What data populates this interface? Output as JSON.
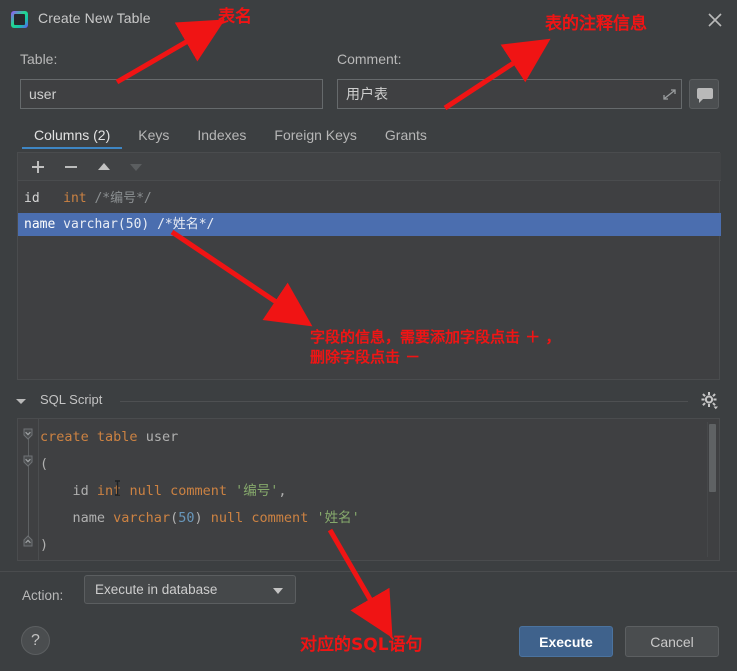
{
  "window": {
    "title": "Create New Table",
    "app_icon": "datagrip-logo-icon",
    "close_icon": "close-icon"
  },
  "form": {
    "table_label": "Table:",
    "table_value": "user",
    "table_placeholder": "",
    "comment_label": "Comment:",
    "comment_value": "用户表",
    "comment_placeholder": "",
    "expand_icon": "expand-icon",
    "comment_button_icon": "speech-bubble-icon"
  },
  "tabs": [
    {
      "label": "Columns (2)",
      "active": true
    },
    {
      "label": "Keys",
      "active": false
    },
    {
      "label": "Indexes",
      "active": false
    },
    {
      "label": "Foreign Keys",
      "active": false
    },
    {
      "label": "Grants",
      "active": false
    }
  ],
  "columns_toolbar": [
    {
      "name": "add-column-button",
      "icon": "plus-icon",
      "label": "+",
      "enabled": true
    },
    {
      "name": "remove-column-button",
      "icon": "minus-icon",
      "label": "−",
      "enabled": true
    },
    {
      "name": "move-up-button",
      "icon": "arrow-up-icon",
      "label": "▲",
      "enabled": true
    },
    {
      "name": "move-down-button",
      "icon": "arrow-down-icon",
      "label": "▼",
      "enabled": false
    }
  ],
  "columns": [
    {
      "name": "id",
      "type": "int",
      "comment": "/*编号*/",
      "selected": false
    },
    {
      "name": "name",
      "type": "varchar(50)",
      "comment": "/*姓名*/",
      "selected": true
    }
  ],
  "sql_section": {
    "title": "SQL Script",
    "collapse_icon": "caret-down-icon",
    "settings_icon": "gear-icon",
    "lines": [
      {
        "indent": 0,
        "tokens": [
          {
            "t": "create",
            "c": "k"
          },
          {
            "t": " ",
            "c": "p"
          },
          {
            "t": "table",
            "c": "k"
          },
          {
            "t": " ",
            "c": "p"
          },
          {
            "t": "user",
            "c": "p"
          }
        ]
      },
      {
        "indent": 0,
        "tokens": [
          {
            "t": "(",
            "c": "p"
          }
        ]
      },
      {
        "indent": 1,
        "tokens": [
          {
            "t": "id",
            "c": "p"
          },
          {
            "t": " ",
            "c": "p"
          },
          {
            "t": "int",
            "c": "k"
          },
          {
            "t": " ",
            "c": "p"
          },
          {
            "t": "null",
            "c": "k"
          },
          {
            "t": " ",
            "c": "p"
          },
          {
            "t": "comment",
            "c": "k"
          },
          {
            "t": " ",
            "c": "p"
          },
          {
            "t": "'编号'",
            "c": "s"
          },
          {
            "t": ",",
            "c": "p"
          }
        ]
      },
      {
        "indent": 1,
        "tokens": [
          {
            "t": "name",
            "c": "p"
          },
          {
            "t": " ",
            "c": "p"
          },
          {
            "t": "varchar",
            "c": "k"
          },
          {
            "t": "(",
            "c": "p"
          },
          {
            "t": "50",
            "c": "n"
          },
          {
            "t": ")",
            "c": "p"
          },
          {
            "t": " ",
            "c": "p"
          },
          {
            "t": "null",
            "c": "k"
          },
          {
            "t": " ",
            "c": "p"
          },
          {
            "t": "comment",
            "c": "k"
          },
          {
            "t": " ",
            "c": "p"
          },
          {
            "t": "'姓名'",
            "c": "s"
          }
        ]
      },
      {
        "indent": 0,
        "tokens": [
          {
            "t": ")",
            "c": "p"
          }
        ]
      }
    ],
    "plain_text": "create table user\n(\n    id int null comment '编号',\n    name varchar(50) null comment '姓名'\n)"
  },
  "footer": {
    "action_label": "Action:",
    "action_value": "Execute in database",
    "action_options": [
      "Execute in database"
    ],
    "help_label": "?",
    "execute_label": "Execute",
    "cancel_label": "Cancel"
  },
  "annotations": [
    {
      "name": "annotation-table-name",
      "text": "表名"
    },
    {
      "name": "annotation-table-comment",
      "text": "表的注释信息"
    },
    {
      "name": "annotation-fields",
      "text": "字段的信息，需要添加字段点击 ＋ ，\n删除字段点击 －"
    },
    {
      "name": "annotation-sql",
      "text": "对应的SQL语句"
    }
  ],
  "colors": {
    "dialog_bg": "#3c3f41",
    "panel_bg": "#3f4042",
    "selection_blue": "#4b6eaf",
    "tab_underline": "#3e86c4",
    "execute_button": "#3f628c",
    "annotation_red": "#f01414",
    "keyword_orange": "#cc8242",
    "string_green": "#86a96c",
    "number_blue": "#6897bb"
  }
}
